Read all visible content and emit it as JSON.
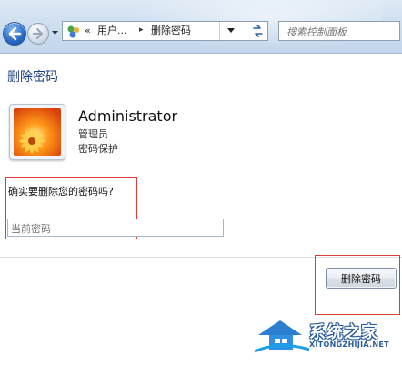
{
  "toolbar": {
    "breadcrumb": {
      "prefix": "«",
      "parent": "用户...",
      "separator": "▸",
      "current": "删除密码"
    },
    "search_placeholder": "搜索控制面板"
  },
  "content": {
    "page_title": "删除密码",
    "user": {
      "name": "Administrator",
      "role": "管理员",
      "status": "密码保护"
    },
    "question": "确实要删除您的密码吗?",
    "password_placeholder": "当前密码",
    "delete_button_label": "删除密码"
  },
  "watermark": {
    "name": "系统之家",
    "url": "XITONGZHIJIA.NET"
  },
  "colors": {
    "title_blue": "#1f3f86",
    "highlight_red": "#e03b3b",
    "toolbar_bg": "#cfdff0"
  },
  "icons": {
    "back": "back-arrow-icon",
    "forward": "forward-arrow-icon",
    "control_panel": "control-panel-icon",
    "refresh": "refresh-icon",
    "avatar": "flower-avatar-icon"
  }
}
